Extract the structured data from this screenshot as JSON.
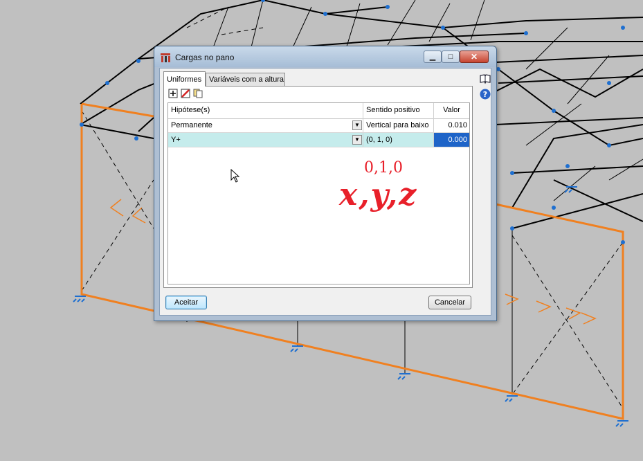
{
  "dialog": {
    "title": "Cargas no pano",
    "tabs": [
      "Uniformes",
      "Variáveis com a altura"
    ],
    "grid": {
      "headers": [
        "Hipótese(s)",
        "Sentido positivo",
        "Valor"
      ],
      "rows": [
        {
          "hypothesis": "Permanente",
          "direction": "Vertical para baixo",
          "value": "0.010"
        },
        {
          "hypothesis": "Y+",
          "direction": "(0, 1, 0)",
          "value": "0.000"
        }
      ]
    },
    "buttons": {
      "accept": "Aceitar",
      "cancel": "Cancelar"
    }
  },
  "annotation": {
    "line1": "0,1,0",
    "line2": "x,y,z"
  },
  "colors": {
    "annotation": "#e8202a",
    "frame_orange": "#f08020",
    "selected_row": "#c5ecec",
    "support_blue": "#1e6fd0"
  },
  "icons": {
    "title": "app-logo-icon",
    "help_book": "book-icon",
    "help": "help-icon",
    "add": "add-row-icon",
    "delete": "delete-row-icon",
    "copy": "copy-icon",
    "cursor": "mouse-pointer-icon"
  }
}
